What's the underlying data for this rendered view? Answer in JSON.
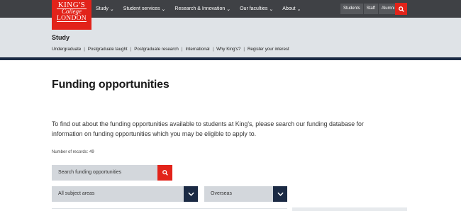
{
  "logo": {
    "line1": "KING'S",
    "line2": "College",
    "line3": "LONDON"
  },
  "nav": {
    "items": [
      {
        "label": "Study"
      },
      {
        "label": "Student services"
      },
      {
        "label": "Research & Innovation"
      },
      {
        "label": "Our faculties"
      },
      {
        "label": "About"
      }
    ],
    "audience": [
      "Students",
      "Staff",
      "Alumni"
    ]
  },
  "section": {
    "title": "Study",
    "links": [
      "Undergraduate",
      "Postgraduate taught",
      "Postgraduate research",
      "International",
      "Why King's?",
      "Register your interest"
    ]
  },
  "main": {
    "title": "Funding opportunities",
    "intro": "To find out about the funding opportunities available to students at King's, please search our funding database for information on funding opportunities which you may be eligible to apply to.",
    "records": "Number of records: 49",
    "search_placeholder": "Search funding opportunities",
    "filter_subject": "All subject areas",
    "filter_location": "Overseas"
  },
  "colors": {
    "brand_red": "#e2231a",
    "navy": "#1b2a44",
    "topbar": "#3f4145"
  }
}
